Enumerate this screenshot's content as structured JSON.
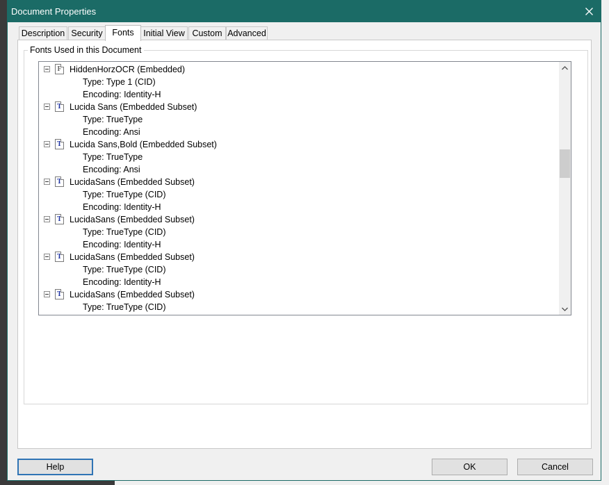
{
  "dialog": {
    "title": "Document Properties"
  },
  "tabs": [
    {
      "label": "Description"
    },
    {
      "label": "Security"
    },
    {
      "label": "Fonts"
    },
    {
      "label": "Initial View"
    },
    {
      "label": "Custom"
    },
    {
      "label": "Advanced"
    }
  ],
  "active_tab": "Fonts",
  "group": {
    "label": "Fonts Used in this Document"
  },
  "fonts": [
    {
      "name": "HiddenHorzOCR (Embedded)",
      "icon": "type1-font-icon",
      "type": "Type: Type 1 (CID)",
      "encoding": "Encoding: Identity-H"
    },
    {
      "name": "Lucida Sans (Embedded Subset)",
      "icon": "truetype-font-icon",
      "type": "Type: TrueType",
      "encoding": "Encoding: Ansi"
    },
    {
      "name": "Lucida Sans,Bold (Embedded Subset)",
      "icon": "truetype-font-icon",
      "type": "Type: TrueType",
      "encoding": "Encoding: Ansi"
    },
    {
      "name": "LucidaSans (Embedded Subset)",
      "icon": "truetype-font-icon",
      "type": "Type: TrueType (CID)",
      "encoding": "Encoding: Identity-H"
    },
    {
      "name": "LucidaSans (Embedded Subset)",
      "icon": "truetype-font-icon",
      "type": "Type: TrueType (CID)",
      "encoding": "Encoding: Identity-H"
    },
    {
      "name": "LucidaSans (Embedded Subset)",
      "icon": "truetype-font-icon",
      "type": "Type: TrueType (CID)",
      "encoding": "Encoding: Identity-H"
    },
    {
      "name": "LucidaSans (Embedded Subset)",
      "icon": "truetype-font-icon",
      "type": "Type: TrueType (CID)",
      "encoding": ""
    }
  ],
  "icons": {
    "type1_glyph": "F",
    "truetype_glyph": "T",
    "close": "close-icon",
    "scroll_up": "chevron-up-icon",
    "scroll_down": "chevron-down-icon"
  },
  "buttons": {
    "help": "Help",
    "ok": "OK",
    "cancel": "Cancel"
  },
  "colors": {
    "titlebar": "#1b6b66",
    "default_button_border": "#2f74b5"
  }
}
